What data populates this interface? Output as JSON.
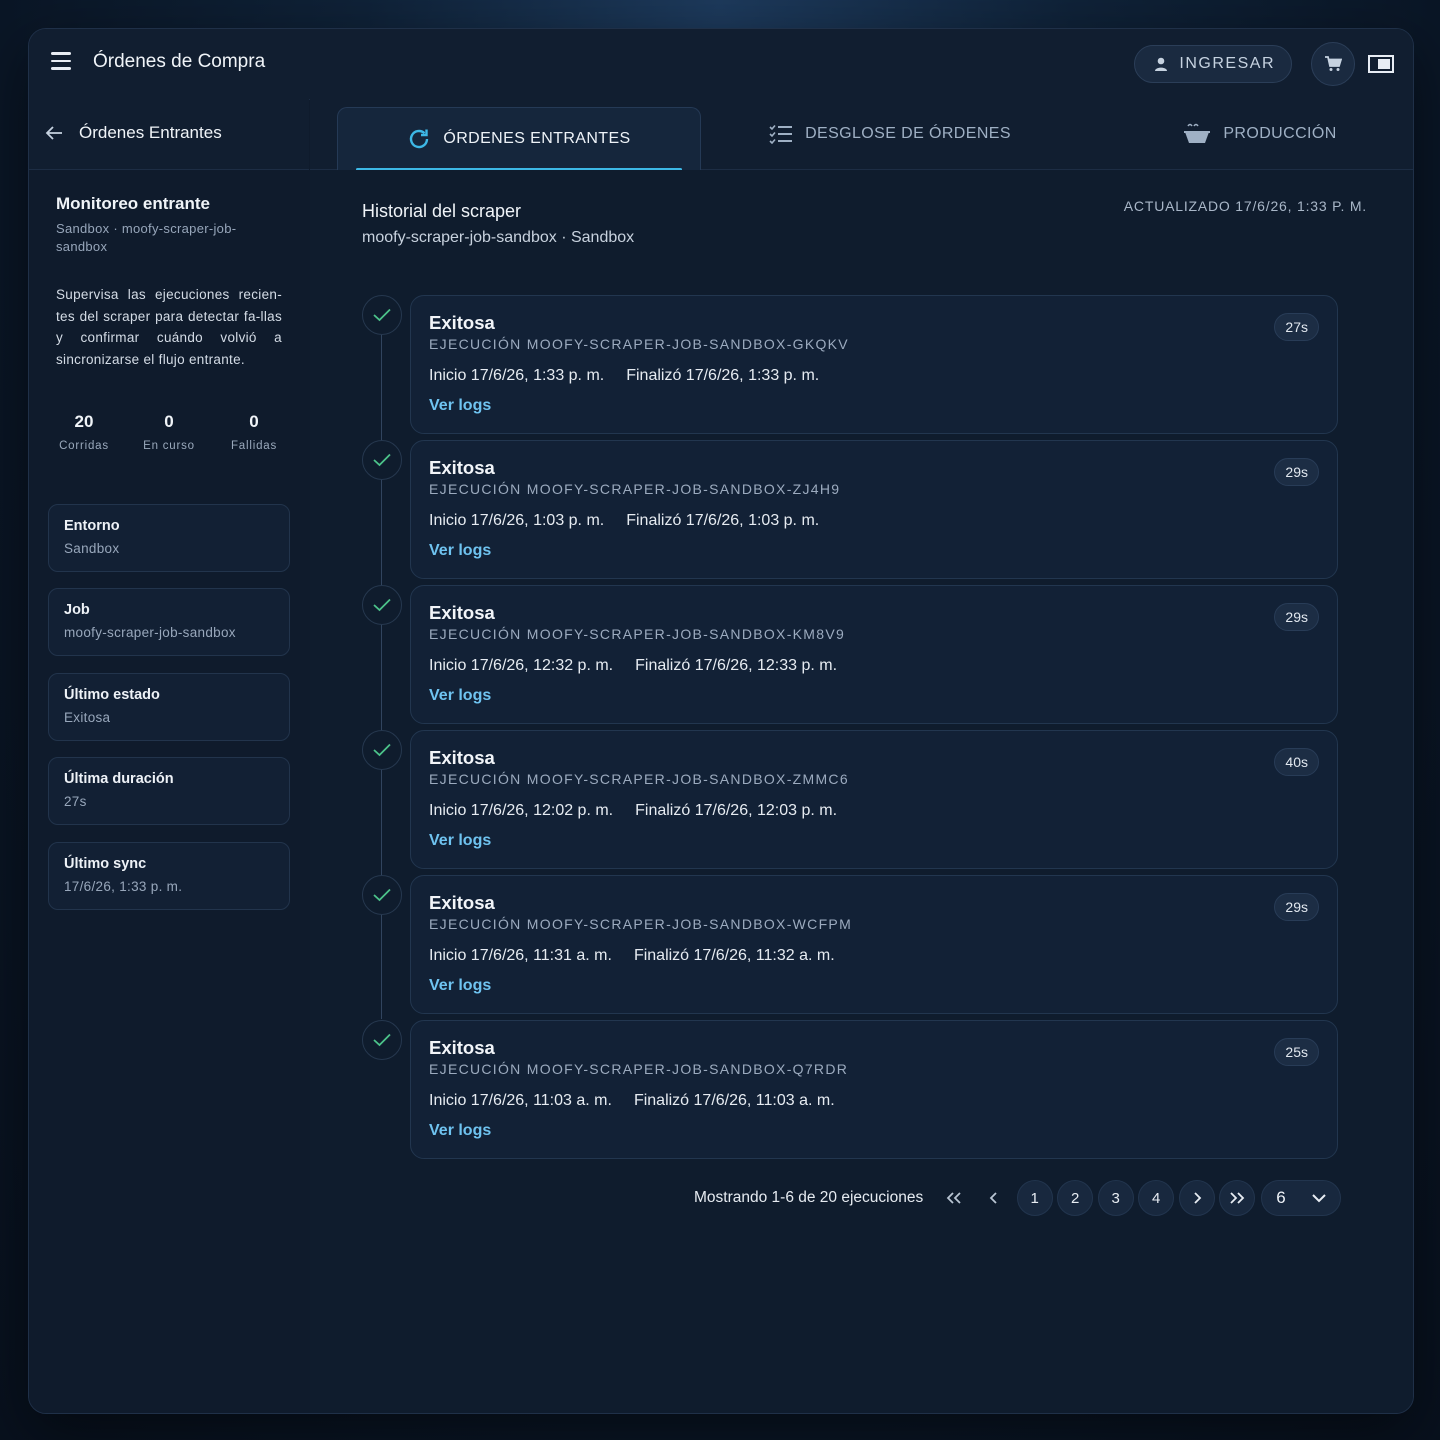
{
  "app": {
    "title": "Órdenes de Compra",
    "login_label": "INGRESAR"
  },
  "sidebar_head": {
    "title": "Órdenes Entrantes"
  },
  "tabs": [
    {
      "label": "ÓRDENES ENTRANTES",
      "icon": "refresh-icon",
      "active": true
    },
    {
      "label": "DESGLOSE DE ÓRDENES",
      "icon": "checklist-icon",
      "active": false
    },
    {
      "label": "PRODUCCIÓN",
      "icon": "food-tray-icon",
      "active": false
    }
  ],
  "sidebar": {
    "title": "Monitoreo entrante",
    "subtitle": "Sandbox · moofy-scraper-job-sandbox",
    "description": "Supervisa las ejecuciones recien-tes del scraper para detectar fa-llas y confirmar cuándo volvió a sincronizarse el flujo entrante.",
    "stats": [
      {
        "value": "20",
        "label": "Corridas"
      },
      {
        "value": "0",
        "label": "En curso"
      },
      {
        "value": "0",
        "label": "Fallidas"
      }
    ],
    "cards": [
      {
        "label": "Entorno",
        "value": "Sandbox"
      },
      {
        "label": "Job",
        "value": "moofy-scraper-job-sandbox"
      },
      {
        "label": "Último estado",
        "value": "Exitosa"
      },
      {
        "label": "Última duración",
        "value": "27s"
      },
      {
        "label": "Último sync",
        "value": "17/6/26, 1:33 p. m."
      }
    ]
  },
  "history": {
    "title": "Historial del scraper",
    "subtitle": "moofy-scraper-job-sandbox · Sandbox",
    "updated": "ACTUALIZADO 17/6/26, 1:33 P. M.",
    "logs_label": "Ver logs",
    "runs": [
      {
        "status": "Exitosa",
        "id": "EJECUCIÓN MOOFY-SCRAPER-JOB-SANDBOX-GKQKV",
        "start": "Inicio 17/6/26, 1:33 p. m.",
        "end": "Finalizó 17/6/26, 1:33 p. m.",
        "duration": "27s"
      },
      {
        "status": "Exitosa",
        "id": "EJECUCIÓN MOOFY-SCRAPER-JOB-SANDBOX-ZJ4H9",
        "start": "Inicio 17/6/26, 1:03 p. m.",
        "end": "Finalizó 17/6/26, 1:03 p. m.",
        "duration": "29s"
      },
      {
        "status": "Exitosa",
        "id": "EJECUCIÓN MOOFY-SCRAPER-JOB-SANDBOX-KM8V9",
        "start": "Inicio 17/6/26, 12:32 p. m.",
        "end": "Finalizó 17/6/26, 12:33 p. m.",
        "duration": "29s"
      },
      {
        "status": "Exitosa",
        "id": "EJECUCIÓN MOOFY-SCRAPER-JOB-SANDBOX-ZMMC6",
        "start": "Inicio 17/6/26, 12:02 p. m.",
        "end": "Finalizó 17/6/26, 12:03 p. m.",
        "duration": "40s"
      },
      {
        "status": "Exitosa",
        "id": "EJECUCIÓN MOOFY-SCRAPER-JOB-SANDBOX-WCFPM",
        "start": "Inicio 17/6/26, 11:31 a. m.",
        "end": "Finalizó 17/6/26, 11:32 a. m.",
        "duration": "29s"
      },
      {
        "status": "Exitosa",
        "id": "EJECUCIÓN MOOFY-SCRAPER-JOB-SANDBOX-Q7RDR",
        "start": "Inicio 17/6/26, 11:03 a. m.",
        "end": "Finalizó 17/6/26, 11:03 a. m.",
        "duration": "25s"
      }
    ]
  },
  "pagination": {
    "summary": "Mostrando 1-6 de 20 ejecuciones",
    "pages": [
      "1",
      "2",
      "3",
      "4"
    ],
    "page_size": "6"
  },
  "colors": {
    "accent": "#3db8e6",
    "link": "#6fc3f0",
    "success": "#4cc38a"
  }
}
